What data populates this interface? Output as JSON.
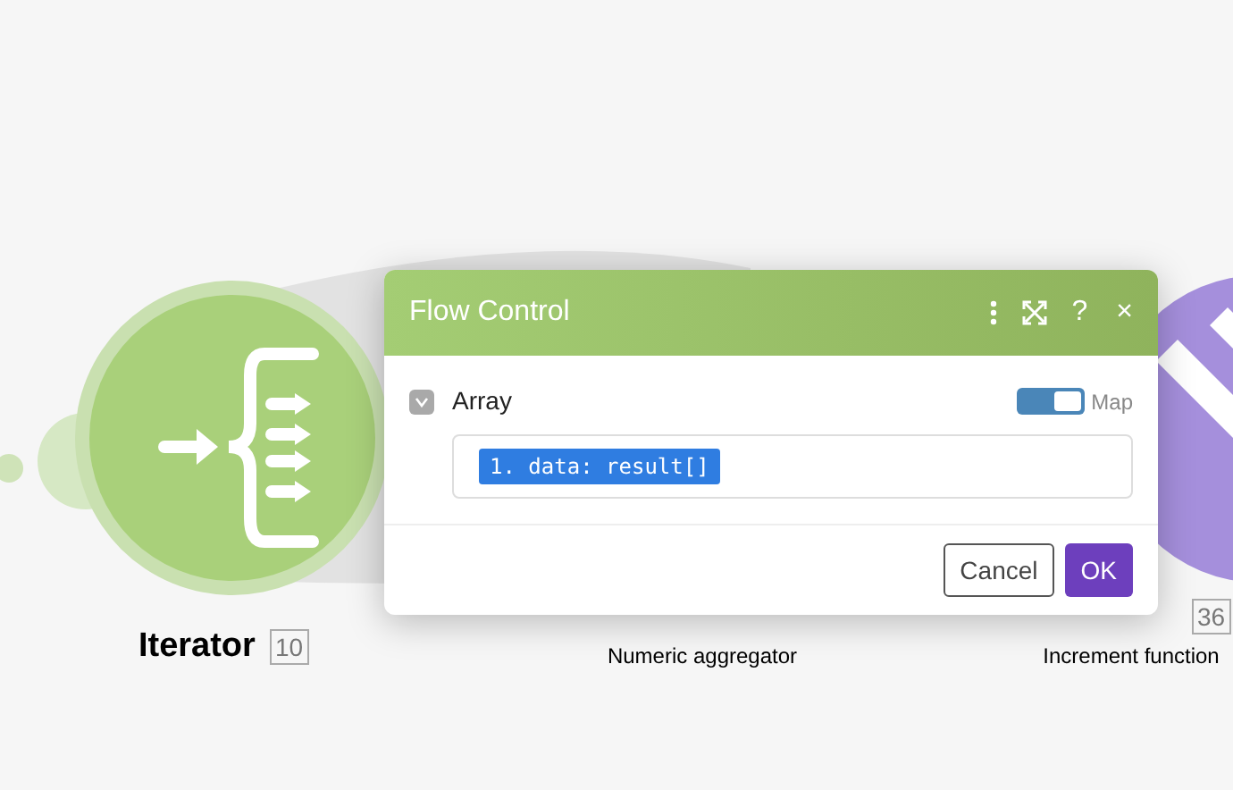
{
  "nodes": [
    {
      "kind": "iterator",
      "title": "Iterator",
      "badge": "10"
    },
    {
      "subtitle": "Numeric aggregator"
    },
    {
      "kind": "tools",
      "badge": "36",
      "subtitle": "Increment function"
    }
  ],
  "dialog": {
    "title": "Flow Control",
    "header_actions": [
      "?",
      "×"
    ],
    "fields": [
      {
        "label": "Array",
        "expanded": false,
        "map": {
          "label": "Map",
          "on": true
        },
        "value": "1. data: result[]"
      }
    ],
    "buttons": [
      {
        "label": "Cancel",
        "kind": "secondary"
      },
      {
        "label": "OK",
        "kind": "primary"
      }
    ]
  }
}
